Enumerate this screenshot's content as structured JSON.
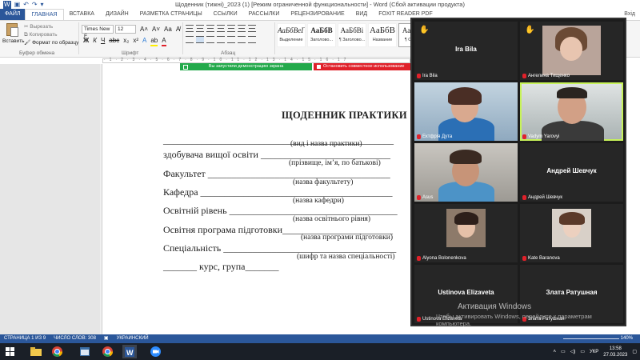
{
  "window": {
    "title": "Щоденник (тижні)_2023 (1) [Режим ограниченной функциональности] - Word (Сбой активации продукта)",
    "user": "Вхід"
  },
  "ribbon_tabs": [
    "ФАЙЛ",
    "ГЛАВНАЯ",
    "ВСТАВКА",
    "ДИЗАЙН",
    "РАЗМЕТКА СТРАНИЦЫ",
    "ССЫЛКИ",
    "РАССЫЛКИ",
    "РЕЦЕНЗИРОВАНИЕ",
    "ВИД",
    "FOXIT READER PDF"
  ],
  "clipboard": {
    "paste": "Вставить",
    "cut": "Вырезать",
    "copy": "Копировать",
    "format_painter": "Формат по образцу",
    "group": "Буфер обмена"
  },
  "font": {
    "name": "Times New F",
    "size": "12",
    "group": "Шрифт"
  },
  "paragraph": {
    "group": "Абзац"
  },
  "styles": [
    {
      "sample": "АаБбВеГ",
      "name": "Выделение"
    },
    {
      "sample": "АаБбВ",
      "name": "Заголово..."
    },
    {
      "sample": "АаБбВі",
      "name": "¶ Заголово..."
    },
    {
      "sample": "АаБбВ",
      "name": "Название"
    },
    {
      "sample": "АаБбВ",
      "name": "¶ Обы..."
    }
  ],
  "share": {
    "started": "Вы запустили демонстрацию экрана",
    "stop": "Остановить совместное использование"
  },
  "document": {
    "title": "ЩОДЕННИК ПРАКТИКИ",
    "lines": [
      {
        "text": "________________________________________________"
      },
      {
        "text": "здобувача вищої освіти ___________________________"
      },
      {
        "text": "Факультет ______________________________________"
      },
      {
        "text": "Кафедра ________________________________________"
      },
      {
        "text": "Освітній рівень ___________________________________"
      },
      {
        "text": "Освітня програма підготовки_______________________"
      },
      {
        "text": "Спеціальність ____________________________________"
      },
      {
        "text": "_______ курс, група_______"
      }
    ],
    "hints": [
      "(вид і назва практики)",
      "(прізвище, ім’я, по батькові)",
      "(назва факультету)",
      "(назва кафедри)",
      "(назва освітнього рівня)",
      "(назва програми  підготовки)",
      "(шифр та назва спеціальності)"
    ]
  },
  "participants": [
    {
      "label": "Ira Bila",
      "center": "Ira Bila",
      "hand": true
    },
    {
      "label": "Ангелина Тищенко",
      "hand": true
    },
    {
      "label": "Ектфрія Дута"
    },
    {
      "label": "Vadym Yarovyi",
      "active": true
    },
    {
      "label": "Asus"
    },
    {
      "label": "Андрей Шевчук",
      "center": "Андрей Шевчук"
    },
    {
      "label": "Alyona Bolonenkova"
    },
    {
      "label": "Kate Baranova"
    },
    {
      "label": "Ustinova Elizaveta",
      "center": "Ustinova Elizaveta"
    },
    {
      "label": "Злата Ратушная",
      "center": "Злата Ратушная"
    }
  ],
  "watermark": {
    "title": "Активация Windows",
    "subtitle": "Чтобы активировать Windows, перейдите к параметрам компьютера."
  },
  "status": {
    "page": "СТРАНИЦА 1 ИЗ 9",
    "words": "ЧИСЛО СЛОВ: 308",
    "language": "УКРАИНСКИЙ",
    "zoom": "140%"
  },
  "taskbar": {
    "lang": "УКР",
    "time": "13:58",
    "date": "27.03.2023"
  },
  "colors": {
    "word_blue": "#2b579a",
    "share_green": "#23a94b",
    "stop_red": "#e0212a",
    "active_tile": "#c7f25a"
  }
}
